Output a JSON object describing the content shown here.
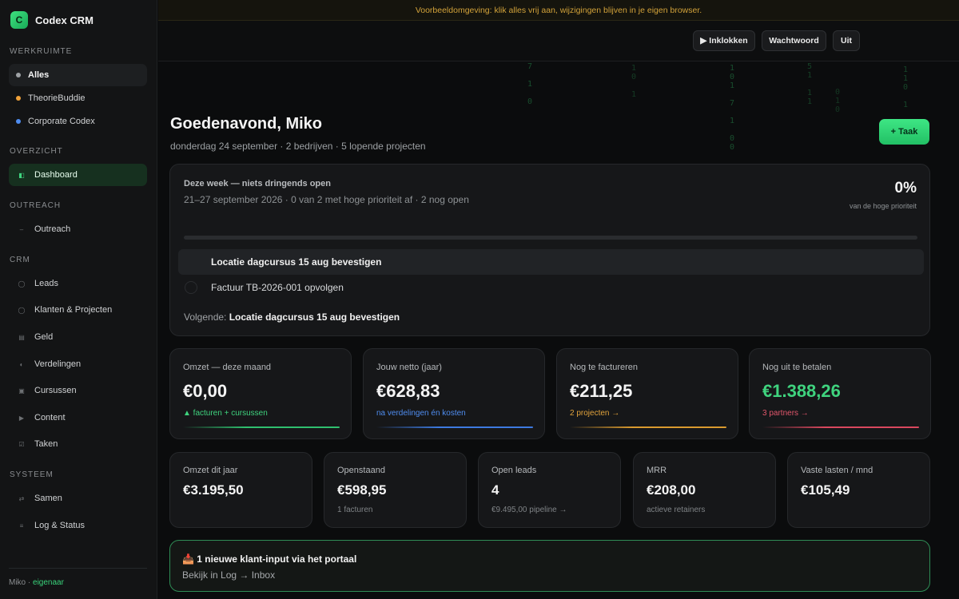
{
  "app": {
    "name": "Codex CRM",
    "logo_letter": "C"
  },
  "banner": "Voorbeeldomgeving: klik alles vrij aan, wijzigingen blijven in je eigen browser.",
  "topbar": {
    "clock_in": "▶ Inklokken",
    "password": "Wachtwoord",
    "logout": "Uit"
  },
  "sidebar": {
    "workspace_label": "WERKRUIMTE",
    "workspaces": [
      {
        "label": "Alles",
        "color": "#9ea2a5"
      },
      {
        "label": "TheorieBuddie",
        "color": "#f0a23a"
      },
      {
        "label": "Corporate Codex",
        "color": "#4f8df0"
      }
    ],
    "overview_label": "OVERZICHT",
    "dashboard": "Dashboard",
    "outreach_label": "OUTREACH",
    "outreach": "Outreach",
    "crm_label": "CRM",
    "crm_items": [
      "Leads",
      "Klanten & Projecten",
      "Geld",
      "Verdelingen",
      "Cursussen",
      "Content",
      "Taken"
    ],
    "system_label": "SYSTEEM",
    "system_items": [
      "Samen",
      "Log & Status"
    ],
    "footer_user": "Miko",
    "footer_sep": " · ",
    "footer_role": "eigenaar"
  },
  "header": {
    "greeting": "Goedenavond, Miko",
    "subtitle": "donderdag 24 september · 2 bedrijven · 5 lopende projecten",
    "add_task": "+ Taak"
  },
  "week": {
    "title": "Deze week — niets dringends open",
    "subtitle": "21–27 september 2026 · 0 van 2 met hoge prioriteit af · 2 nog open",
    "percent": "0%",
    "percent_label": "van de hoge prioriteit",
    "progress": 0,
    "tasks": [
      "Locatie dagcursus 15 aug bevestigen",
      "Factuur TB-2026-001 opvolgen"
    ],
    "next_label": "Volgende: ",
    "next_task": "Locatie dagcursus 15 aug bevestigen"
  },
  "stats": [
    {
      "label": "Omzet — deze maand",
      "value": "€0,00",
      "note": "▲ facturen + cursussen",
      "note_color": "#3fd37e",
      "line_color": "#2fbf6e"
    },
    {
      "label": "Jouw netto (jaar)",
      "value": "€628,83",
      "note": "na verdelingen én kosten",
      "note_color": "#4f8df0",
      "line_color": "#3d7ae0"
    },
    {
      "label": "Nog te factureren",
      "value": "€211,25",
      "note": "2 projecten →",
      "note_color": "#e2a33c",
      "line_color": "#d99a2f"
    },
    {
      "label": "Nog uit te betalen",
      "value": "€1.388,26",
      "note": "3 partners →",
      "note_color": "#e0566b",
      "line_color": "#d9485e",
      "value_color": "#3fd37e"
    }
  ],
  "mini_stats": [
    {
      "label": "Omzet dit jaar",
      "value": "€3.195,50",
      "note": ""
    },
    {
      "label": "Openstaand",
      "value": "€598,95",
      "note": "1 facturen"
    },
    {
      "label": "Open leads",
      "value": "4",
      "note": "€9.495,00 pipeline →"
    },
    {
      "label": "MRR",
      "value": "€208,00",
      "note": "actieve retainers"
    },
    {
      "label": "Vaste lasten / mnd",
      "value": "€105,49",
      "note": ""
    }
  ],
  "portal": {
    "icon": "inbox-tray-icon",
    "title": "📥 1 nieuwe klant-input via het portaal",
    "subtitle": "Bekijk in Log → Inbox"
  }
}
